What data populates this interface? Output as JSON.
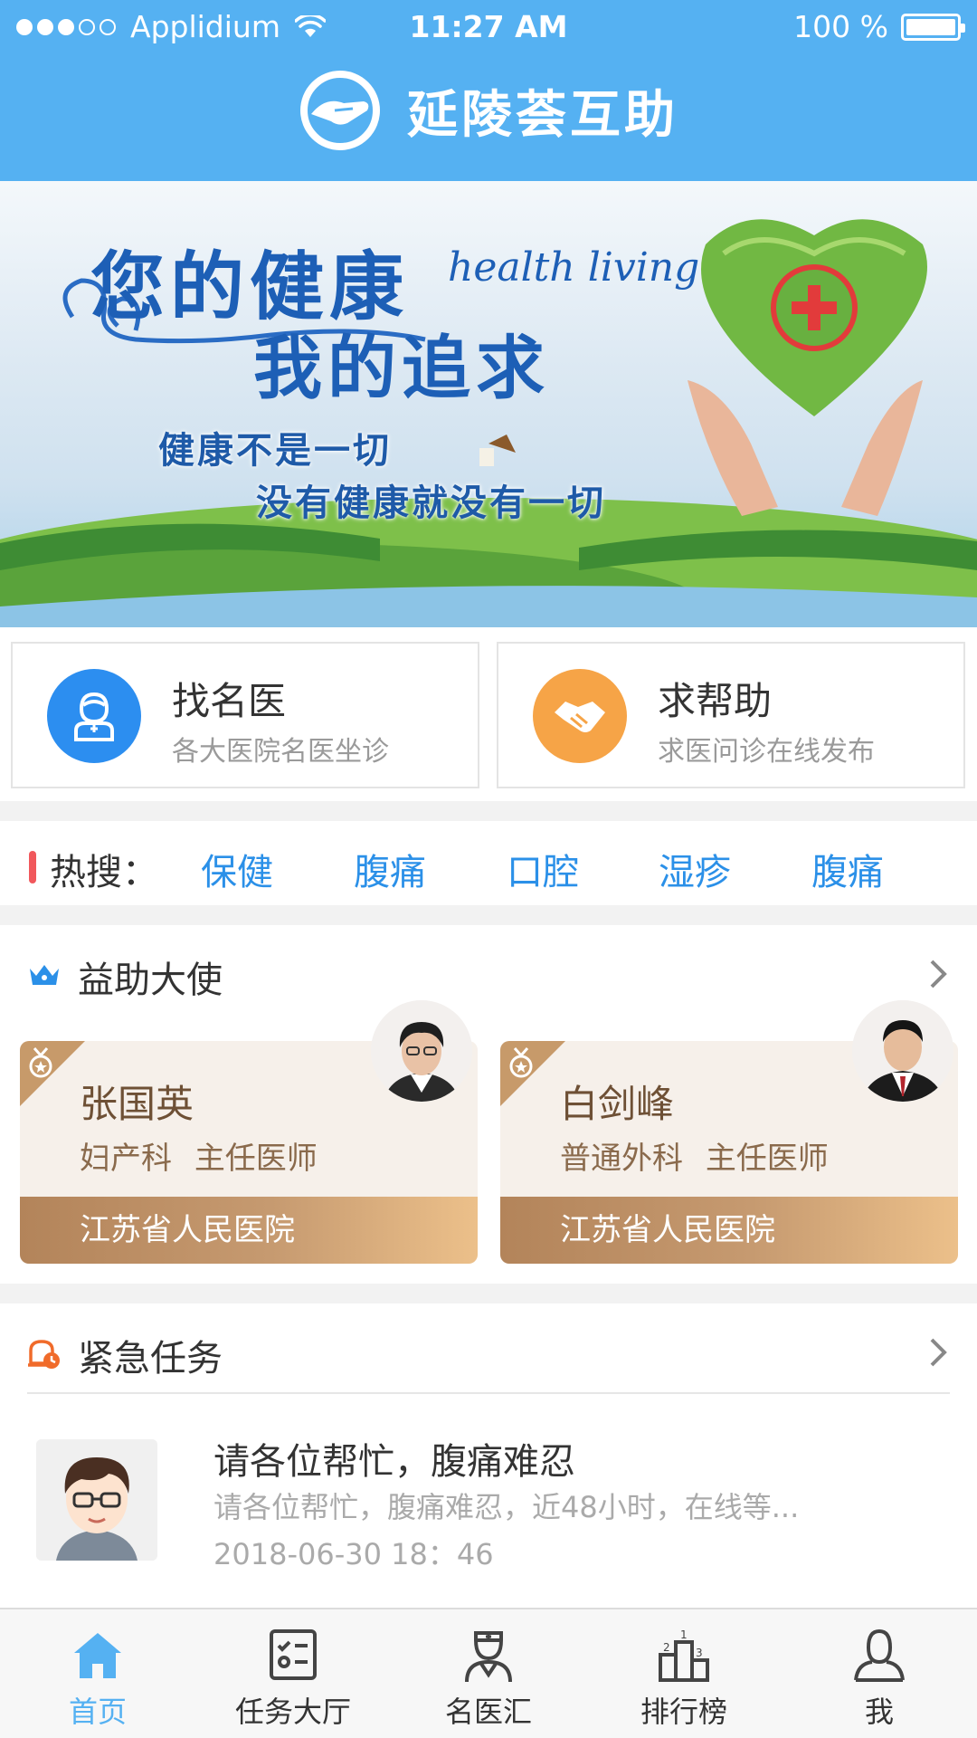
{
  "status_bar": {
    "carrier": "Applidium",
    "time": "11:27 AM",
    "battery": "100 %"
  },
  "header": {
    "title": "延陵荟互助"
  },
  "banner": {
    "line1": "您的健康",
    "english": "health living",
    "line2": "我的追求",
    "line3": "健康不是一切",
    "line4": "没有健康就没有一切"
  },
  "quick_entries": [
    {
      "title": "找名医",
      "subtitle": "各大医院名医坐诊",
      "icon": "doctor-icon",
      "color": "#2c8ef0"
    },
    {
      "title": "求帮助",
      "subtitle": "求医问诊在线发布",
      "icon": "handshake-icon",
      "color": "#f6a447"
    }
  ],
  "hot_search": {
    "label": "热搜：",
    "tags": [
      "保健",
      "腹痛",
      "口腔",
      "湿疹",
      "腹痛"
    ]
  },
  "ambassadors": {
    "title": "益助大使",
    "items": [
      {
        "name": "张国英",
        "department": "妇产科",
        "position": "主任医师",
        "hospital": "江苏省人民医院"
      },
      {
        "name": "白剑峰",
        "department": "普通外科",
        "position": "主任医师",
        "hospital": "江苏省人民医院"
      }
    ]
  },
  "urgent_tasks": {
    "title": "紧急任务",
    "items": [
      {
        "title": "请各位帮忙，腹痛难忍",
        "description": "请各位帮忙，腹痛难忍，近48小时，在线等...",
        "time": "2018-06-30  18：46"
      }
    ]
  },
  "tabbar": {
    "tabs": [
      {
        "label": "首页",
        "icon": "home-icon",
        "active": true
      },
      {
        "label": "任务大厅",
        "icon": "task-list-icon",
        "active": false
      },
      {
        "label": "名医汇",
        "icon": "doctor-icon",
        "active": false
      },
      {
        "label": "排行榜",
        "icon": "podium-icon",
        "active": false
      },
      {
        "label": "我",
        "icon": "user-icon",
        "active": false
      }
    ]
  },
  "colors": {
    "header_bg": "#55b1f2",
    "link_blue": "#2b90e8",
    "accent_orange": "#f6a447",
    "gold": "#c69a70"
  }
}
